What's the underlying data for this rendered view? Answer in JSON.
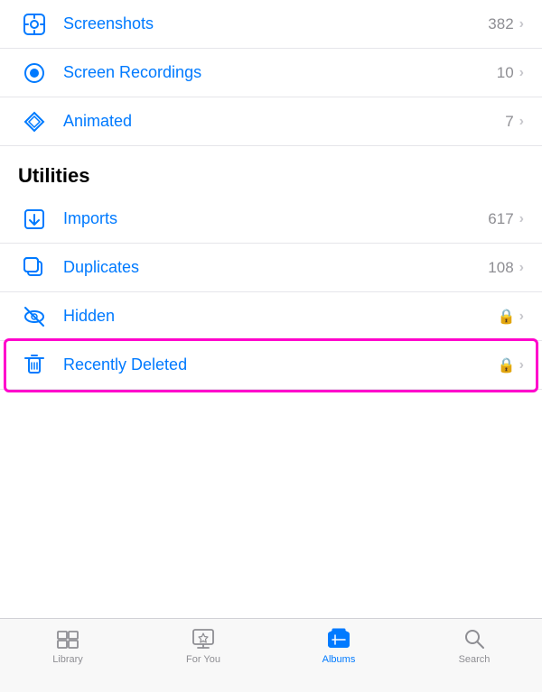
{
  "items": [
    {
      "name": "Screenshots",
      "count": "382",
      "hasLock": false,
      "icon": "screenshots"
    },
    {
      "name": "Screen Recordings",
      "count": "10",
      "hasLock": false,
      "icon": "screen-recordings"
    },
    {
      "name": "Animated",
      "count": "7",
      "hasLock": false,
      "icon": "animated"
    }
  ],
  "section": {
    "title": "Utilities"
  },
  "utilities": [
    {
      "name": "Imports",
      "count": "617",
      "hasLock": false,
      "icon": "imports"
    },
    {
      "name": "Duplicates",
      "count": "108",
      "hasLock": false,
      "icon": "duplicates"
    },
    {
      "name": "Hidden",
      "count": "",
      "hasLock": true,
      "icon": "hidden"
    },
    {
      "name": "Recently Deleted",
      "count": "",
      "hasLock": true,
      "icon": "recently-deleted",
      "highlighted": true
    }
  ],
  "tabs": [
    {
      "label": "Library",
      "icon": "library",
      "active": false
    },
    {
      "label": "For You",
      "icon": "for-you",
      "active": false
    },
    {
      "label": "Albums",
      "icon": "albums",
      "active": true
    },
    {
      "label": "Search",
      "icon": "search",
      "active": false
    }
  ]
}
